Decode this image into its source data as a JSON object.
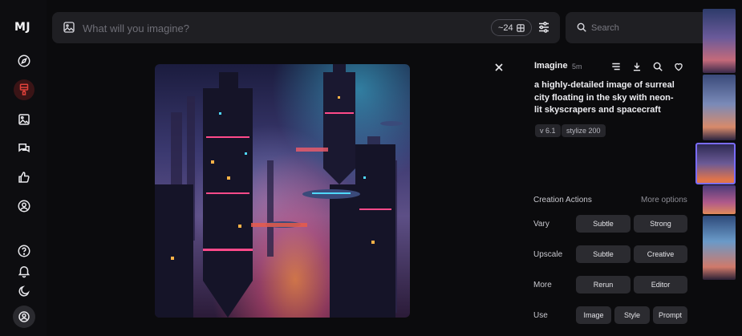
{
  "app": {
    "logo": "MJ"
  },
  "rail": {
    "top_icons": [
      "compass-icon",
      "brush-icon",
      "image-icon",
      "chat-icon",
      "thumbs-up-icon",
      "user-circle-icon"
    ],
    "bottom_icons": [
      "help-icon",
      "bell-icon",
      "moon-icon",
      "avatar-icon"
    ],
    "accent": "#e0413a"
  },
  "prompt_bar": {
    "placeholder": "What will you imagine?",
    "count": "~24"
  },
  "search": {
    "placeholder": "Search"
  },
  "panel": {
    "title": "Imagine",
    "time": "5m",
    "prompt": "a highly-detailed image of surreal city floating in the sky with neon-lit skyscrapers and spacecraft",
    "tags": [
      "v 6.1",
      "stylize 200"
    ],
    "creation_actions": {
      "title": "Creation Actions",
      "more": "More options",
      "rows": [
        {
          "label": "Vary",
          "buttons": [
            "Subtle",
            "Strong"
          ]
        },
        {
          "label": "Upscale",
          "buttons": [
            "Subtle",
            "Creative"
          ]
        },
        {
          "label": "More",
          "buttons": [
            "Rerun",
            "Editor"
          ]
        },
        {
          "label": "Use",
          "buttons": [
            "Image",
            "Style",
            "Prompt"
          ]
        }
      ]
    }
  },
  "colors": {
    "background": "#0b0b0d",
    "bar": "#1f1f23",
    "button": "#2b2b30",
    "selected_outline": "#7a6cff"
  }
}
